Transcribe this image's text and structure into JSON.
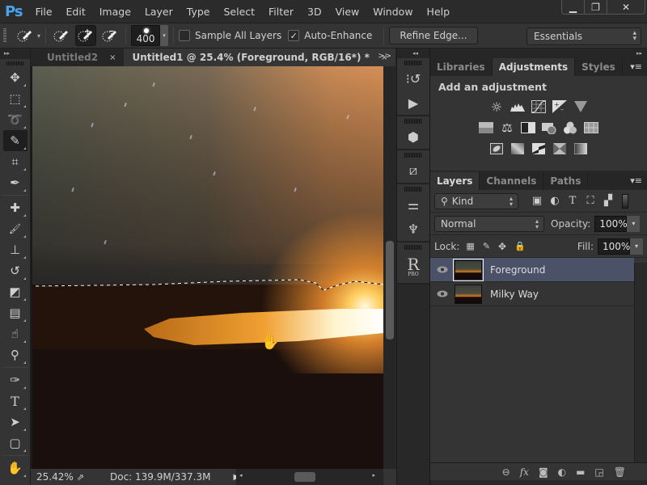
{
  "app": {
    "logo": "Ps"
  },
  "menu": [
    "File",
    "Edit",
    "Image",
    "Layer",
    "Type",
    "Select",
    "Filter",
    "3D",
    "View",
    "Window",
    "Help"
  ],
  "window_controls": {
    "minimize": "▁",
    "restore": "❐",
    "close": "✕"
  },
  "options_bar": {
    "brush_size": "400",
    "sample_all_layers": {
      "label": "Sample All Layers",
      "checked": false
    },
    "auto_enhance": {
      "label": "Auto-Enhance",
      "checked": true
    },
    "refine_edge_label": "Refine Edge...",
    "workspace": "Essentials"
  },
  "toolbox": {
    "collapse_label": "▸▸",
    "tools": [
      {
        "name": "move-tool",
        "glyph": "✥"
      },
      {
        "name": "rectangular-marquee-tool",
        "glyph": "⬚"
      },
      {
        "name": "lasso-tool",
        "glyph": "➰"
      },
      {
        "name": "quick-selection-tool",
        "glyph": "✎",
        "active": true
      },
      {
        "name": "crop-tool",
        "glyph": "⌗"
      },
      {
        "name": "eyedropper-tool",
        "glyph": "✒"
      },
      {
        "name": "spot-healing-brush-tool",
        "glyph": "✚"
      },
      {
        "name": "brush-tool",
        "glyph": "🖌"
      },
      {
        "name": "clone-stamp-tool",
        "glyph": "⊥"
      },
      {
        "name": "history-brush-tool",
        "glyph": "↺"
      },
      {
        "name": "eraser-tool",
        "glyph": "◩"
      },
      {
        "name": "gradient-tool",
        "glyph": "▤"
      },
      {
        "name": "blur-tool",
        "glyph": "☝"
      },
      {
        "name": "dodge-tool",
        "glyph": "⚲"
      },
      {
        "name": "pen-tool",
        "glyph": "✑"
      },
      {
        "name": "type-tool",
        "glyph": "T"
      },
      {
        "name": "path-selection-tool",
        "glyph": "➤"
      },
      {
        "name": "rectangle-tool",
        "glyph": "▢"
      },
      {
        "name": "hand-tool",
        "glyph": "✋"
      }
    ]
  },
  "doc_tabs": [
    {
      "label": "Untitled2",
      "active": false,
      "close": "×"
    },
    {
      "label": "Untitled1 @ 25.4% (Foreground, RGB/16*) *",
      "active": true,
      "close": "×"
    }
  ],
  "tabs_overflow": ">>",
  "status": {
    "zoom": "25.42%",
    "doc": "Doc: 139.9M/337.3M"
  },
  "panels": {
    "collapse_label": "◂◂",
    "expand_label": "▸▸",
    "adjust_tabs": [
      {
        "label": "Libraries",
        "active": false
      },
      {
        "label": "Adjustments",
        "active": true
      },
      {
        "label": "Styles",
        "active": false
      }
    ],
    "adjust_title": "Add an adjustment",
    "adjust_rows": [
      [
        "brightness-contrast",
        "levels",
        "curves",
        "exposure",
        "vibrance"
      ],
      [
        "hue-saturation",
        "color-balance",
        "black-white",
        "photo-filter",
        "channel-mixer",
        "color-lookup"
      ],
      [
        "invert",
        "posterize",
        "threshold",
        "selective-color",
        "gradient-map"
      ]
    ],
    "layers_tabs": [
      {
        "label": "Layers",
        "active": true
      },
      {
        "label": "Channels",
        "active": false
      },
      {
        "label": "Paths",
        "active": false
      }
    ],
    "filter_kind": "Kind",
    "blend_mode": "Normal",
    "opacity_label": "Opacity:",
    "opacity": "100%",
    "lock_label": "Lock:",
    "fill_label": "Fill:",
    "fill": "100%",
    "layers": [
      {
        "name": "Foreground",
        "selected": true,
        "visible": true
      },
      {
        "name": "Milky Way",
        "selected": false,
        "visible": true
      }
    ]
  }
}
